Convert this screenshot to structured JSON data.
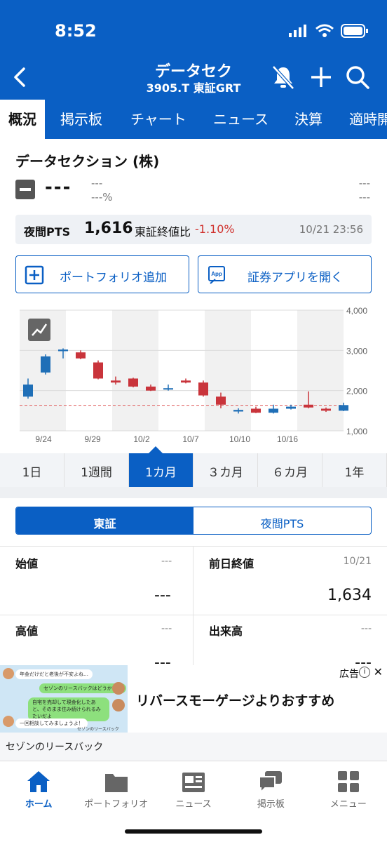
{
  "status_bar": {
    "time": "8:52"
  },
  "header": {
    "title": "データセク",
    "subtitle": "3905.T 東証GRT"
  },
  "tabs": [
    {
      "label": "概況",
      "active": true
    },
    {
      "label": "掲示板"
    },
    {
      "label": "チャート"
    },
    {
      "label": "ニュース"
    },
    {
      "label": "決算"
    },
    {
      "label": "適時開"
    }
  ],
  "company": {
    "name": "データセクション (株)",
    "price": "---",
    "change": "---",
    "change_pct": "---%",
    "right_1": "---",
    "right_2": "---"
  },
  "pts": {
    "label": "夜間PTS",
    "value": "1,616",
    "compare_label": "東証終値比",
    "change": "-1.10%",
    "time": "10/21 23:56"
  },
  "actions": {
    "portfolio": "ポートフォリオ追加",
    "app": "証券アプリを開く",
    "app_icon_text": "App"
  },
  "chart_data": {
    "type": "candlestick",
    "y_ticks": [
      "4,000",
      "3,000",
      "2,000",
      "1,000"
    ],
    "ylim": [
      1000,
      4000
    ],
    "x_tick_labels": [
      "9/24",
      "9/29",
      "10/2",
      "10/7",
      "10/10",
      "10/16"
    ],
    "reference_line": 1634,
    "candles": [
      {
        "o": 1850,
        "c": 2150,
        "h": 2300,
        "l": 1800
      },
      {
        "o": 2450,
        "c": 2850,
        "h": 2900,
        "l": 2400
      },
      {
        "o": 2980,
        "c": 3020,
        "h": 3050,
        "l": 2800
      },
      {
        "o": 2950,
        "c": 2800,
        "h": 3000,
        "l": 2780
      },
      {
        "o": 2700,
        "c": 2300,
        "h": 2750,
        "l": 2280
      },
      {
        "o": 2250,
        "c": 2200,
        "h": 2350,
        "l": 2150
      },
      {
        "o": 2300,
        "c": 2100,
        "h": 2320,
        "l": 2080
      },
      {
        "o": 2100,
        "c": 2000,
        "h": 2150,
        "l": 1990
      },
      {
        "o": 2050,
        "c": 2060,
        "h": 2150,
        "l": 2000
      },
      {
        "o": 2250,
        "c": 2200,
        "h": 2300,
        "l": 2180
      },
      {
        "o": 2200,
        "c": 1880,
        "h": 2250,
        "l": 1850
      },
      {
        "o": 1850,
        "c": 1650,
        "h": 1950,
        "l": 1560
      },
      {
        "o": 1480,
        "c": 1520,
        "h": 1560,
        "l": 1430
      },
      {
        "o": 1550,
        "c": 1450,
        "h": 1600,
        "l": 1440
      },
      {
        "o": 1450,
        "c": 1550,
        "h": 1650,
        "l": 1430
      },
      {
        "o": 1550,
        "c": 1600,
        "h": 1650,
        "l": 1530
      },
      {
        "o": 1650,
        "c": 1580,
        "h": 1980,
        "l": 1560
      },
      {
        "o": 1550,
        "c": 1500,
        "h": 1580,
        "l": 1470
      },
      {
        "o": 1500,
        "c": 1640,
        "h": 1700,
        "l": 1490
      }
    ],
    "colors": {
      "up": "#1f6fb7",
      "down": "#c9343b",
      "ref": "#e05757"
    }
  },
  "ranges": [
    {
      "label": "1日"
    },
    {
      "label": "1週間"
    },
    {
      "label": "1カ月",
      "active": true
    },
    {
      "label": "３カ月"
    },
    {
      "label": "６カ月"
    },
    {
      "label": "1年"
    }
  ],
  "market_toggle": {
    "tse": "東証",
    "pts": "夜間PTS"
  },
  "stats": {
    "open_label": "始値",
    "open_date": "---",
    "open_value": "---",
    "prev_label": "前日終値",
    "prev_date": "10/21",
    "prev_value": "1,634",
    "high_label": "高値",
    "high_date": "---",
    "high_value": "---",
    "vol_label": "出来高",
    "vol_date": "---",
    "vol_value": "---"
  },
  "ad": {
    "label": "広告",
    "headline": "リバースモーゲージよりおすすめ",
    "sponsor": "セゾンのリースバック",
    "bubbles": [
      "年金だけだと老後が不安よね…",
      "セゾンのリースバックはどうかな？",
      "自宅を売却して現金化したあと、そのまま住み続けられるみたいだよ",
      "一回相談してみましょうよ！"
    ],
    "brand": "セゾンのリースバック"
  },
  "bottom_nav": [
    {
      "label": "ホーム",
      "active": true
    },
    {
      "label": "ポートフォリオ"
    },
    {
      "label": "ニュース"
    },
    {
      "label": "掲示板"
    },
    {
      "label": "メニュー"
    }
  ],
  "colors": {
    "brand": "#0a5fc4",
    "negative": "#d0312d"
  }
}
